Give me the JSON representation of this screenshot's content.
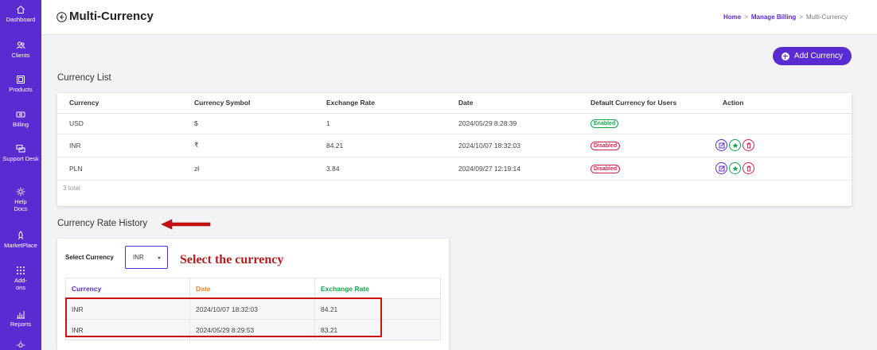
{
  "sidebar": {
    "items": [
      {
        "label": "Dashboard",
        "icon": "home-icon"
      },
      {
        "label": "Clients",
        "icon": "users-icon"
      },
      {
        "label": "Products",
        "icon": "box-icon"
      },
      {
        "label": "Billing",
        "icon": "billing-icon"
      },
      {
        "label": "Support Desk",
        "icon": "support-icon"
      },
      {
        "label": "Help Docs",
        "icon": "gear-icon"
      },
      {
        "label": "MarketPlace",
        "icon": "rocket-icon"
      },
      {
        "label": "Add-ons",
        "icon": "grid-icon"
      },
      {
        "label": "Reports",
        "icon": "chart-icon"
      }
    ],
    "color": "#5a2bd0"
  },
  "header": {
    "title": "Multi-Currency",
    "breadcrumb": {
      "home": "Home",
      "parent": "Manage Billing",
      "current": "Multi-Currency",
      "separator": ">"
    }
  },
  "add_button": {
    "label": "Add Currency"
  },
  "currency_list": {
    "title": "Currency List",
    "columns": [
      "Currency",
      "Currency Symbol",
      "Exchange Rate",
      "Date",
      "Default Currency for Users",
      "Action"
    ],
    "rows": [
      {
        "currency": "USD",
        "symbol": "$",
        "rate": "1",
        "date": "2024/05/29 8:28:39",
        "status": "Enabled"
      },
      {
        "currency": "INR",
        "symbol": "₹",
        "rate": "84.21",
        "date": "2024/10/07 18:32:03",
        "status": "Disabled"
      },
      {
        "currency": "PLN",
        "symbol": "zł",
        "rate": "3.84",
        "date": "2024/09/27 12:19:14",
        "status": "Disabled"
      }
    ],
    "total": "3 total"
  },
  "rate_history": {
    "title": "Currency Rate History",
    "select_label": "Select Currency",
    "selected_currency": "INR",
    "columns": [
      "Currency",
      "Date",
      "Exchange Rate"
    ],
    "rows": [
      {
        "currency": "INR",
        "date": "2024/10/07 18:32:03",
        "rate": "84.21"
      },
      {
        "currency": "INR",
        "date": "2024/05/29 8:29:53",
        "rate": "83.21"
      }
    ]
  },
  "annotations": {
    "select_hint": "Select the currency",
    "color": "#cc1111"
  }
}
